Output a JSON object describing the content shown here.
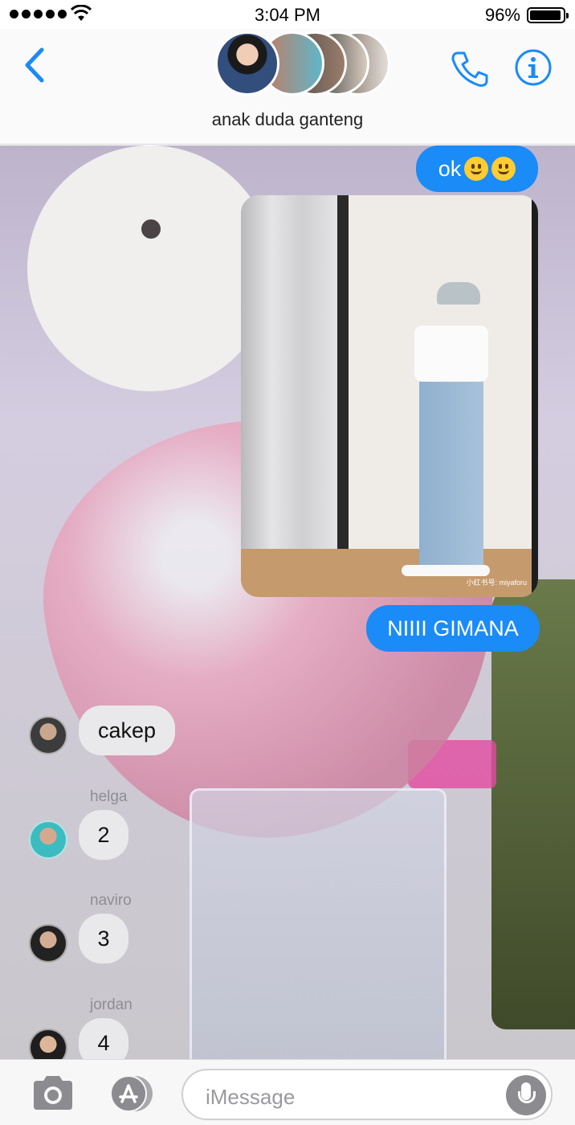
{
  "status_bar": {
    "time": "3:04 PM",
    "battery": "96%",
    "battery_level": 0.96
  },
  "header": {
    "group_name": "anak duda ganteng",
    "back_icon": "chevron-left-icon",
    "call_icon": "phone-icon",
    "info_icon": "info-icon",
    "accent_color": "#1a8bf7"
  },
  "messages": [
    {
      "direction": "outgoing",
      "text": "ok",
      "emoji": "slightly-smiling-face",
      "emoji_count": 2
    },
    {
      "direction": "outgoing",
      "type": "photo",
      "watermark": "小红书号: miyaforu"
    },
    {
      "direction": "outgoing",
      "text": "NIIII GIMANA"
    },
    {
      "direction": "incoming",
      "sender": "",
      "text": "cakep"
    },
    {
      "direction": "incoming",
      "sender": "helga",
      "text": "2"
    },
    {
      "direction": "incoming",
      "sender": "naviro",
      "text": "3"
    },
    {
      "direction": "incoming",
      "sender": "jordan",
      "text": "4"
    }
  ],
  "input": {
    "placeholder": "iMessage",
    "camera_icon": "camera-icon",
    "apps_icon": "app-store-icon",
    "mic_icon": "microphone-icon"
  },
  "colors": {
    "outgoing_bubble": "#1a8bf7",
    "incoming_bubble": "#e9e9eb"
  }
}
